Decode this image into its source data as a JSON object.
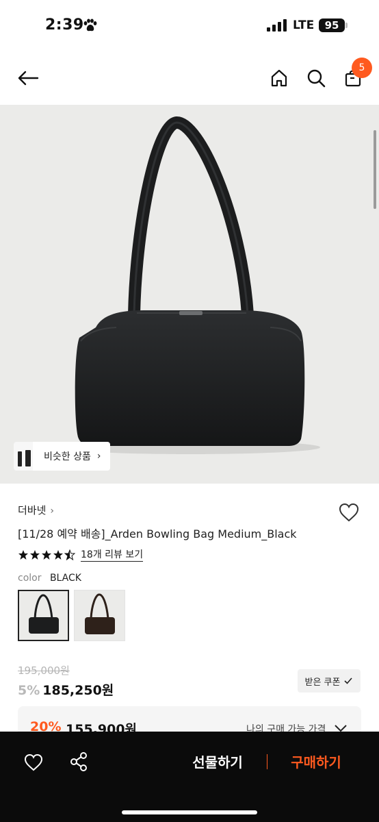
{
  "status_bar": {
    "time": "2:39",
    "network": "LTE",
    "battery": "95"
  },
  "header": {
    "cart_count": "5"
  },
  "similar": {
    "label": "비슷한 상품"
  },
  "product": {
    "brand": "더바넷",
    "title": "[11/28 예약 배송]_Arden Bowling Bag Medium_Black",
    "rating": 4.5,
    "review_link": "18개 리뷰 보기",
    "color_label": "color",
    "color_value": "BLACK",
    "swatches": [
      "BLACK",
      "BROWN"
    ]
  },
  "pricing": {
    "original": "195,000원",
    "sale_rate": "5%",
    "sale_price": "185,250원",
    "coupon_label": "받은 쿠폰",
    "best_rate": "20%",
    "best_price": "155,900원",
    "best_label": "나의 구매 가능 가격"
  },
  "bottom_bar": {
    "gift_label": "선물하기",
    "buy_label": "구매하기"
  },
  "colors": {
    "accent": "#ff5a1f",
    "bar_bg": "#0b0b0b",
    "hero_bg": "#ebebe9"
  }
}
